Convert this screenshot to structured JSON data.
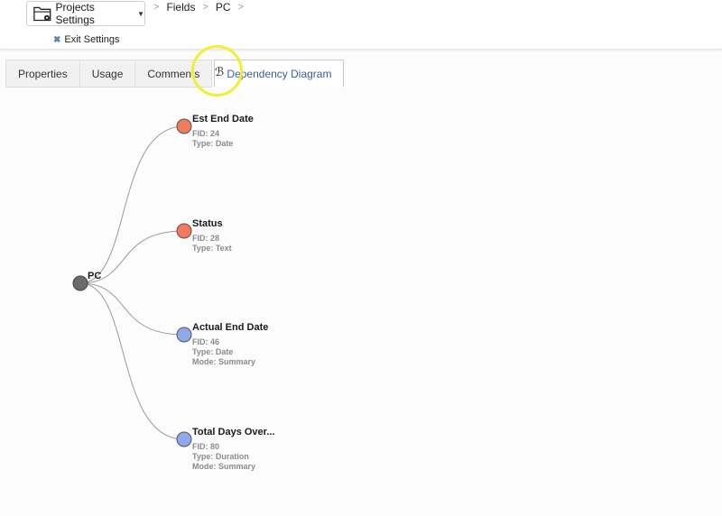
{
  "header": {
    "settings_label": "Projects Settings",
    "breadcrumb": [
      "Fields",
      "PC"
    ],
    "exit_label": "Exit Settings"
  },
  "tabs": [
    {
      "label": "Properties"
    },
    {
      "label": "Usage"
    },
    {
      "label": "Comments"
    },
    {
      "label": "Dependency Diagram",
      "active": true
    }
  ],
  "diagram": {
    "root": {
      "label": "PC",
      "color": "#6b6b6b"
    },
    "children": [
      {
        "label": "Est End Date",
        "color": "#f07b5f",
        "meta": [
          "FID: 24",
          "Type: Date"
        ]
      },
      {
        "label": "Status",
        "color": "#f07b5f",
        "meta": [
          "FID: 28",
          "Type: Text"
        ]
      },
      {
        "label": "Actual End Date",
        "color": "#8fa9ea",
        "meta": [
          "FID: 46",
          "Type: Date",
          "Mode: Summary"
        ]
      },
      {
        "label": "Total Days Over...",
        "color": "#8fa9ea",
        "meta": [
          "FID: 80",
          "Type: Duration",
          "Mode: Summary"
        ]
      }
    ]
  }
}
